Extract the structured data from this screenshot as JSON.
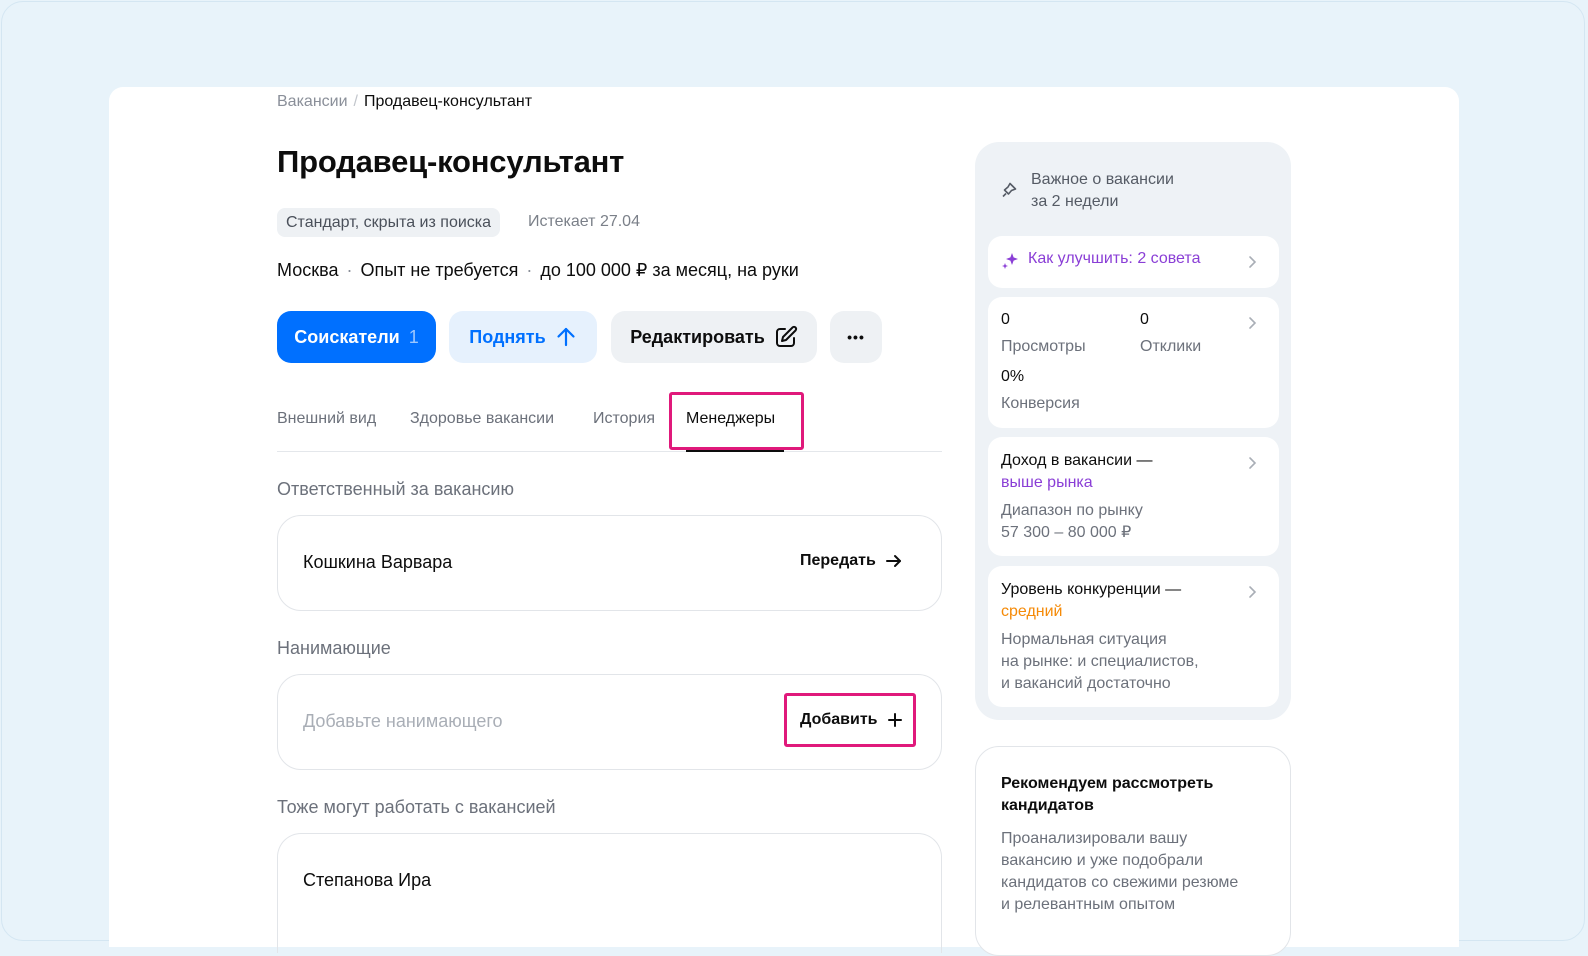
{
  "breadcrumb": {
    "parent": "Вакансии",
    "separator": "/",
    "current": "Продавец-консультант"
  },
  "vacancy": {
    "title": "Продавец-консультант",
    "tag": "Стандарт, скрыта из поиска",
    "expires": "Истекает 27.04",
    "city": "Москва",
    "experience": "Опыт не требуется",
    "salary": "до 100 000 ₽ за месяц, на руки",
    "meta_sep": "·"
  },
  "actions": {
    "applicants_label": "Соискатели",
    "applicants_count": "1",
    "raise_label": "Поднять",
    "edit_label": "Редактировать",
    "more_label": "•••"
  },
  "tabs": [
    {
      "label": "Внешний вид"
    },
    {
      "label": "Здоровье вакансии"
    },
    {
      "label": "История"
    },
    {
      "label": "Менеджеры"
    }
  ],
  "managers": {
    "responsible_title": "Ответственный за вакансию",
    "responsible_name": "Кошкина Варвара",
    "transfer_label": "Передать",
    "hiring_title": "Нанимающие",
    "hiring_placeholder": "Добавьте нанимающего",
    "add_label": "Добавить",
    "others_title": "Тоже могут работать с вакансией",
    "other_name": "Степанова Ира"
  },
  "sidebar": {
    "header_line1": "Важное о вакансии",
    "header_line2": "за 2 недели",
    "improve": "Как улучшить: 2 совета",
    "stats": {
      "views_value": "0",
      "views_label": "Просмотры",
      "responses_value": "0",
      "responses_label": "Отклики",
      "conversion_value": "0%",
      "conversion_label": "Конверсия"
    },
    "income": {
      "title": "Доход в вакансии —",
      "status": "выше рынка",
      "range_label": "Диапазон по рынку",
      "range_value": "57 300 – 80 000 ₽"
    },
    "competition": {
      "title": "Уровень конкуренции —",
      "status": "средний",
      "line1": "Нормальная ситуация",
      "line2": "на рынке: и специалистов,",
      "line3": "и вакансий достаточно"
    },
    "recommend": {
      "title_line1": "Рекомендуем рассмотреть",
      "title_line2": "кандидатов",
      "line1": "Проанализировали вашу",
      "line2": "вакансию и уже подобрали",
      "line3": "кандидатов со свежими резюме",
      "line4": "и релевантным опытом"
    }
  },
  "colors": {
    "accent": "#0070ff",
    "highlight": "#e0197b",
    "purple": "#8a3ed6",
    "orange": "#f58a07"
  }
}
